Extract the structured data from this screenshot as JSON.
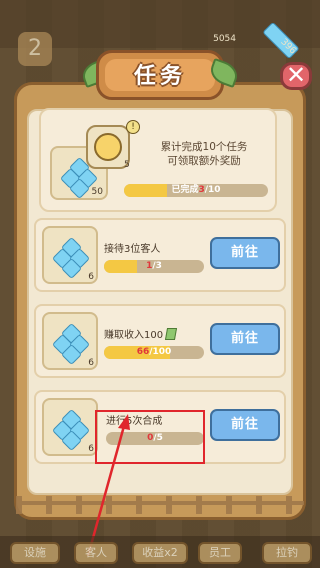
{
  "header": {
    "coins": "5054",
    "gems": "396",
    "level": "2"
  },
  "dialog": {
    "title": "任务"
  },
  "reward": {
    "description_line1": "累计完成10个任务",
    "description_line2": "可领取额外奖励",
    "chest_count": "5",
    "gem_count": "50",
    "progress_prefix": "已完成",
    "progress_current": "3",
    "progress_total": "/10",
    "progress_fraction": 0.3
  },
  "tasks": [
    {
      "name": "接待3位客人",
      "reward_count": "6",
      "current": "1",
      "total": "/3",
      "fraction": 0.333,
      "button": "前往"
    },
    {
      "name": "赚取收入100",
      "reward_count": "6",
      "current": "66",
      "total": "/100",
      "fraction": 0.66,
      "button": "前往"
    },
    {
      "name": "进行5次合成",
      "reward_count": "6",
      "current": "0",
      "total": "/5",
      "fraction": 0.0,
      "button": "前往"
    }
  ],
  "bottom_nav": [
    "设施",
    "客人",
    "收益x2",
    "员工",
    "拉钓"
  ],
  "colors": {
    "go_button": "#7ab7ec",
    "progress_fill": "#f4c843",
    "current_value": "#e0373b",
    "highlight": "#e0262c"
  }
}
